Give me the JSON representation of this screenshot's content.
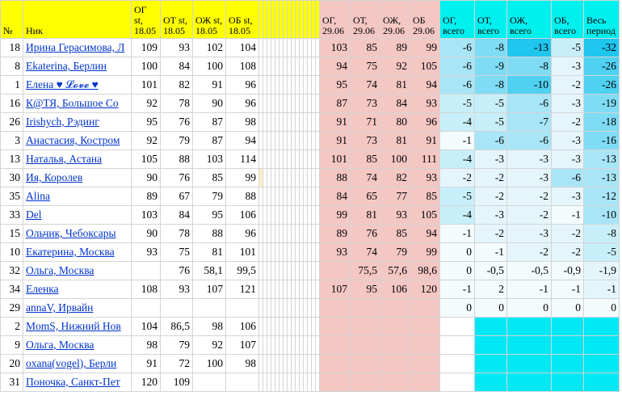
{
  "headers": {
    "idx": "№",
    "nick": "Ник",
    "og_start": "ОГ st, 18.05",
    "ot_start": "ОТ st, 18.05",
    "oj_start": "ОЖ st, 18.05",
    "ob_start": "ОБ st, 18.05",
    "og_end": "ОГ, 29.06",
    "ot_end": "ОТ, 29.06",
    "oj_end": "ОЖ, 29.06",
    "ob_end": "ОБ 29.06",
    "og_total": "ОГ, всего",
    "ot_total": "ОТ, всего",
    "oj_total": "ОЖ, всего",
    "ob_total": "ОБ, всего",
    "period_total": "Весь период"
  },
  "rows": [
    {
      "idx": "18",
      "nick": "Ирина Герасимова, Л",
      "s": [
        "109",
        "93",
        "102",
        "104"
      ],
      "e": [
        "103",
        "85",
        "89",
        "99"
      ],
      "d": [
        "-6",
        "-8",
        "-13",
        "-5",
        "-32"
      ]
    },
    {
      "idx": "8",
      "nick": "Ekaterina, Берлин",
      "s": [
        "100",
        "84",
        "100",
        "108"
      ],
      "e": [
        "94",
        "75",
        "92",
        "105"
      ],
      "d": [
        "-6",
        "-9",
        "-8",
        "-3",
        "-26"
      ]
    },
    {
      "idx": "1",
      "nick": "Елена ♥ 𝓛𝓸𝓿𝓮 ♥",
      "s": [
        "101",
        "82",
        "91",
        "96"
      ],
      "e": [
        "95",
        "74",
        "81",
        "94"
      ],
      "d": [
        "-6",
        "-8",
        "-10",
        "-2",
        "-26"
      ]
    },
    {
      "idx": "16",
      "nick": "К@ТЯ, Большое Со",
      "s": [
        "92",
        "78",
        "90",
        "96"
      ],
      "e": [
        "87",
        "73",
        "84",
        "93"
      ],
      "d": [
        "-5",
        "-5",
        "-6",
        "-3",
        "-19"
      ]
    },
    {
      "idx": "26",
      "nick": "Irishych, Рэдинг",
      "s": [
        "95",
        "76",
        "87",
        "98"
      ],
      "e": [
        "91",
        "71",
        "80",
        "96"
      ],
      "d": [
        "-4",
        "-5",
        "-7",
        "-2",
        "-18"
      ]
    },
    {
      "idx": "3",
      "nick": "Анастасия, Костром",
      "s": [
        "92",
        "79",
        "87",
        "94"
      ],
      "e": [
        "91",
        "73",
        "81",
        "91"
      ],
      "d": [
        "-1",
        "-6",
        "-6",
        "-3",
        "-16"
      ]
    },
    {
      "idx": "13",
      "nick": "Наталья, Астана",
      "s": [
        "105",
        "88",
        "103",
        "114"
      ],
      "e": [
        "101",
        "85",
        "100",
        "111"
      ],
      "d": [
        "-4",
        "-3",
        "-3",
        "-3",
        "-13"
      ]
    },
    {
      "idx": "30",
      "nick": "Ия, Королев",
      "s": [
        "90",
        "76",
        "85",
        "99"
      ],
      "e": [
        "88",
        "74",
        "82",
        "93"
      ],
      "d": [
        "-2",
        "-2",
        "-3",
        "-6",
        "-13"
      ]
    },
    {
      "idx": "35",
      "nick": "Alina",
      "s": [
        "89",
        "67",
        "79",
        "88"
      ],
      "e": [
        "84",
        "65",
        "77",
        "85"
      ],
      "d": [
        "-5",
        "-2",
        "-2",
        "-3",
        "-12"
      ]
    },
    {
      "idx": "33",
      "nick": "Del",
      "s": [
        "103",
        "84",
        "95",
        "106"
      ],
      "e": [
        "99",
        "81",
        "93",
        "105"
      ],
      "d": [
        "-4",
        "-3",
        "-2",
        "-1",
        "-10"
      ]
    },
    {
      "idx": "15",
      "nick": "Ольчик, Чебоксары",
      "s": [
        "90",
        "78",
        "88",
        "96"
      ],
      "e": [
        "89",
        "76",
        "85",
        "94"
      ],
      "d": [
        "-1",
        "-2",
        "-3",
        "-2",
        "-8"
      ]
    },
    {
      "idx": "10",
      "nick": "Екатерина, Москва",
      "s": [
        "93",
        "75",
        "81",
        "101"
      ],
      "e": [
        "93",
        "74",
        "79",
        "99"
      ],
      "d": [
        "0",
        "-1",
        "-2",
        "-2",
        "-5"
      ]
    },
    {
      "idx": "32",
      "nick": "Ольга, Москва",
      "s": [
        "",
        "76",
        "58,1",
        "99,5"
      ],
      "e": [
        "",
        "75,5",
        "57,6",
        "98,6"
      ],
      "d": [
        "0",
        "-0,5",
        "-0,5",
        "-0,9",
        "-1,9"
      ]
    },
    {
      "idx": "34",
      "nick": "Еленка",
      "s": [
        "108",
        "93",
        "107",
        "121"
      ],
      "e": [
        "107",
        "95",
        "106",
        "120"
      ],
      "d": [
        "-1",
        "2",
        "-1",
        "-1",
        "-1"
      ]
    },
    {
      "idx": "29",
      "nick": "annaV, Ирвайн",
      "s": [
        "",
        "",
        "",
        ""
      ],
      "e": [
        "",
        "",
        "",
        ""
      ],
      "d": [
        "0",
        "0",
        "0",
        "0",
        "0"
      ]
    },
    {
      "idx": "2",
      "nick": "MomS, Нижний Нов",
      "s": [
        "104",
        "86,5",
        "98",
        "106"
      ],
      "e": [
        "",
        "",
        "",
        ""
      ],
      "d": [
        "",
        "",
        "",
        "",
        ""
      ]
    },
    {
      "idx": "9",
      "nick": "Ольга, Москва",
      "s": [
        "98",
        "79",
        "92",
        "107"
      ],
      "e": [
        "",
        "",
        "",
        ""
      ],
      "d": [
        "",
        "",
        "",
        "",
        ""
      ]
    },
    {
      "idx": "20",
      "nick": "oxana(vogel), Берли",
      "s": [
        "91",
        "72",
        "100",
        "98"
      ],
      "e": [
        "",
        "",
        "",
        ""
      ],
      "d": [
        "",
        "",
        "",
        "",
        ""
      ]
    },
    {
      "idx": "31",
      "nick": "Поночка, Санкт-Пет",
      "s": [
        "120",
        "109",
        "",
        ""
      ],
      "e": [
        "",
        "",
        "",
        ""
      ],
      "d": [
        "",
        "",
        "",
        "",
        ""
      ]
    }
  ],
  "colors": {
    "header_start": "#ffff00",
    "pink": "#f4c7c3",
    "cyan": "#00f0f0",
    "link": "#0033cc"
  }
}
